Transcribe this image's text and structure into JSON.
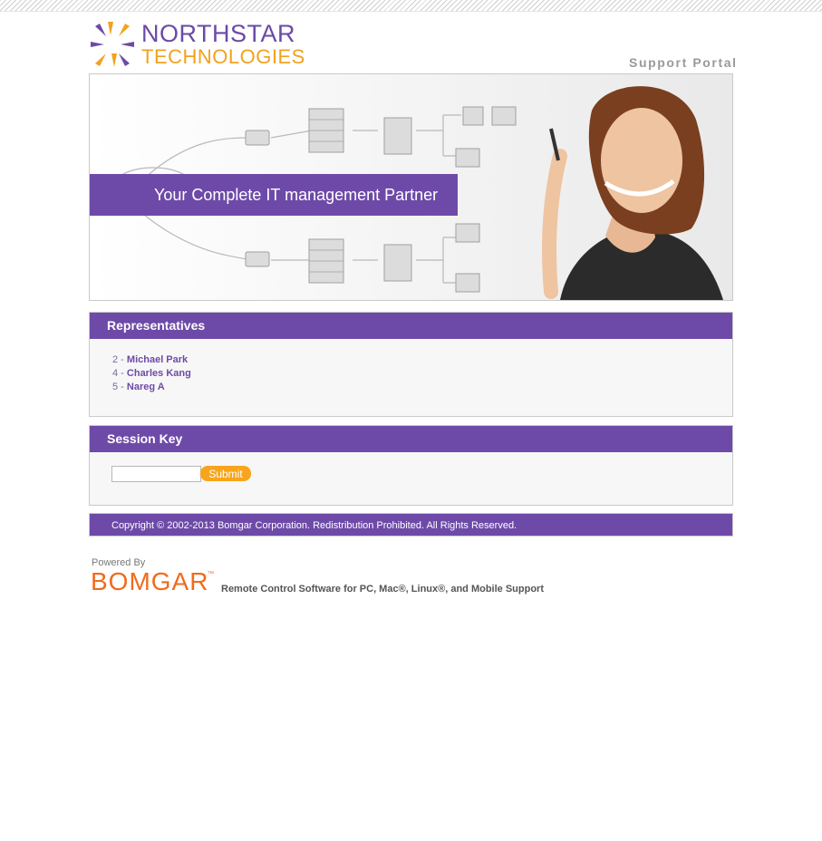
{
  "brand": {
    "line1": "NORTHSTAR",
    "line2": "TECHNOLOGIES",
    "portal_title": "Support Portal"
  },
  "banner": {
    "tagline": "Your Complete IT management Partner"
  },
  "representatives": {
    "title": "Representatives",
    "items": [
      {
        "num": "2 - ",
        "name": "Michael Park"
      },
      {
        "num": "4 - ",
        "name": "Charles Kang"
      },
      {
        "num": "5 - ",
        "name": "Nareg A"
      }
    ]
  },
  "session_key": {
    "title": "Session Key",
    "input_value": "",
    "submit_label": "Submit"
  },
  "footer": {
    "copyright": "Copyright © 2002-2013 Bomgar Corporation. Redistribution Prohibited. All Rights Reserved.",
    "powered_by": "Powered By",
    "bomgar_logo": "BOMGAR",
    "tagline": "Remote Control Software for PC, Mac®, Linux®, and Mobile Support"
  },
  "colors": {
    "accent": "#6e4aa8",
    "brand_orange": "#f2a21c",
    "button": "#f7a51c"
  }
}
